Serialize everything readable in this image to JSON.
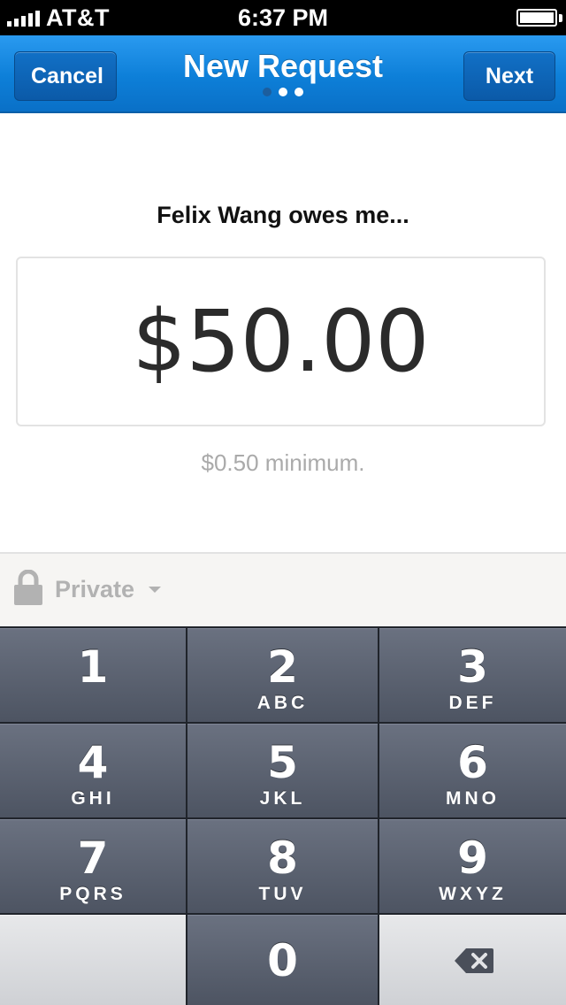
{
  "status_bar": {
    "carrier": "AT&T",
    "time": "6:37 PM"
  },
  "nav": {
    "cancel_label": "Cancel",
    "title": "New Request",
    "next_label": "Next",
    "page_dots": 3,
    "active_dot": 2
  },
  "request": {
    "prompt": "Felix Wang owes me...",
    "amount": "$50.00",
    "minimum_note": "$0.50 minimum."
  },
  "privacy": {
    "label": "Private",
    "icon": "lock-icon"
  },
  "keypad": {
    "keys": [
      {
        "digit": "1",
        "letters": ""
      },
      {
        "digit": "2",
        "letters": "ABC"
      },
      {
        "digit": "3",
        "letters": "DEF"
      },
      {
        "digit": "4",
        "letters": "GHI"
      },
      {
        "digit": "5",
        "letters": "JKL"
      },
      {
        "digit": "6",
        "letters": "MNO"
      },
      {
        "digit": "7",
        "letters": "PQRS"
      },
      {
        "digit": "8",
        "letters": "TUV"
      },
      {
        "digit": "9",
        "letters": "WXYZ"
      },
      {
        "digit": "0",
        "letters": ""
      }
    ],
    "backspace_icon": "backspace-icon"
  },
  "colors": {
    "nav_blue": "#0d7fd8",
    "key_dark": "#4d5462",
    "key_light": "#d4d6da",
    "muted_text": "#aaaaaa"
  }
}
